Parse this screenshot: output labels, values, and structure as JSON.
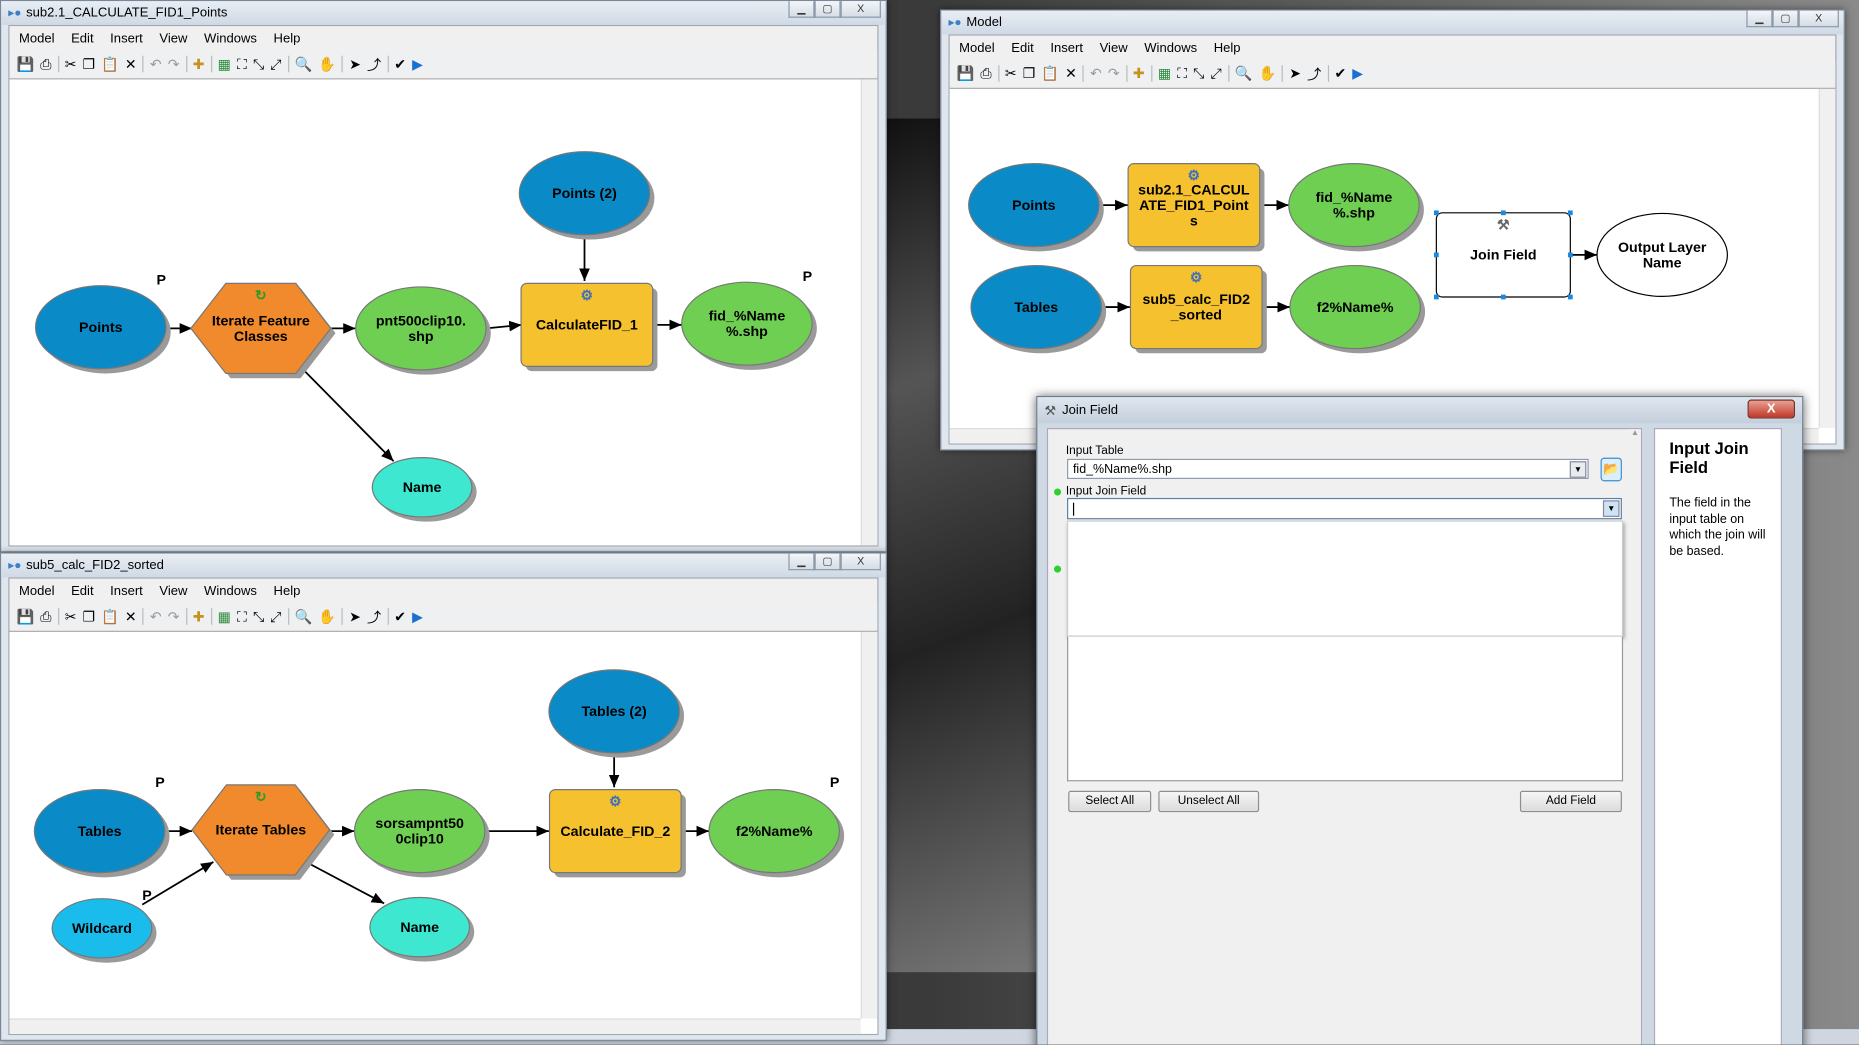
{
  "windows": {
    "w1": {
      "title": "sub2.1_CALCULATE_FID1_Points"
    },
    "w2": {
      "title": "sub5_calc_FID2_sorted"
    },
    "w3": {
      "title": "Model"
    }
  },
  "menu": [
    "Model",
    "Edit",
    "Insert",
    "View",
    "Windows",
    "Help"
  ],
  "toolbar_icons": [
    "save-icon",
    "print-icon",
    "cut-icon",
    "copy-icon",
    "paste-icon",
    "delete-icon",
    "undo-icon",
    "redo-icon",
    "add-data-icon",
    "auto-layout-icon",
    "full-extent-icon",
    "zoom-in-fixed-icon",
    "zoom-out-fixed-icon",
    "zoom-icon",
    "pan-icon",
    "select-icon",
    "connect-icon",
    "validate-icon",
    "run-icon"
  ],
  "colors": {
    "input": "#0a8bc8",
    "tool": "#f5c12e",
    "output": "#6fcf52",
    "iterator": "#f08a2c",
    "variable": "#3ee8d0",
    "wildcard": "#1abcec"
  },
  "diagrams": {
    "w1": {
      "nodes": [
        {
          "id": "points2",
          "kind": "input",
          "lines": [
            "Points (2)"
          ]
        },
        {
          "id": "points",
          "kind": "input",
          "lines": [
            "Points"
          ]
        },
        {
          "id": "iter",
          "kind": "iterator",
          "lines": [
            "Iterate Feature",
            "Classes"
          ]
        },
        {
          "id": "pnt",
          "kind": "output",
          "lines": [
            "pnt500clip10.",
            "shp"
          ]
        },
        {
          "id": "calc",
          "kind": "tool",
          "lines": [
            "CalculateFID_1"
          ]
        },
        {
          "id": "fid",
          "kind": "output",
          "lines": [
            "fid_%Name",
            "%.shp"
          ]
        },
        {
          "id": "name",
          "kind": "variable",
          "lines": [
            "Name"
          ]
        }
      ],
      "p_labels": [
        "P",
        "P"
      ]
    },
    "w2": {
      "nodes": [
        {
          "id": "tables2",
          "kind": "input",
          "lines": [
            "Tables (2)"
          ]
        },
        {
          "id": "tables",
          "kind": "input",
          "lines": [
            "Tables"
          ]
        },
        {
          "id": "iter",
          "kind": "iterator",
          "lines": [
            "Iterate Tables"
          ]
        },
        {
          "id": "sors",
          "kind": "output",
          "lines": [
            "sorsampnt50",
            "0clip10"
          ]
        },
        {
          "id": "calc",
          "kind": "tool",
          "lines": [
            "Calculate_FID_2"
          ]
        },
        {
          "id": "f2",
          "kind": "output",
          "lines": [
            "f2%Name%"
          ]
        },
        {
          "id": "wild",
          "kind": "wildcard",
          "lines": [
            "Wildcard"
          ]
        },
        {
          "id": "name",
          "kind": "variable",
          "lines": [
            "Name"
          ]
        }
      ],
      "p_labels": [
        "P",
        "P",
        "P"
      ]
    },
    "w3": {
      "nodes": [
        {
          "id": "points",
          "kind": "input",
          "lines": [
            "Points"
          ]
        },
        {
          "id": "sub2",
          "kind": "tool",
          "lines": [
            "sub2.1_CALCUL",
            "ATE_FID1_Point",
            "s"
          ]
        },
        {
          "id": "fid",
          "kind": "output",
          "lines": [
            "fid_%Name",
            "%.shp"
          ]
        },
        {
          "id": "tables",
          "kind": "input",
          "lines": [
            "Tables"
          ]
        },
        {
          "id": "sub5",
          "kind": "tool",
          "lines": [
            "sub5_calc_FID2",
            "_sorted"
          ]
        },
        {
          "id": "f2",
          "kind": "output",
          "lines": [
            "f2%Name%"
          ]
        },
        {
          "id": "join",
          "kind": "blank-tool",
          "lines": [
            "Join Field"
          ]
        },
        {
          "id": "out",
          "kind": "blank-output",
          "lines": [
            "Output Layer",
            "Name"
          ]
        }
      ],
      "p_labels": []
    }
  },
  "dialog": {
    "title": "Join Field",
    "input_table_label": "Input Table",
    "input_table_value": "fid_%Name%.shp",
    "input_join_field_label": "Input Join Field",
    "input_join_field_value": "",
    "buttons": {
      "select_all": "Select All",
      "unselect_all": "Unselect All",
      "add_field": "Add Field"
    },
    "close_label": "X",
    "help_title": "Input Join Field",
    "help_text": "The field in the input table on which the join will be based."
  }
}
